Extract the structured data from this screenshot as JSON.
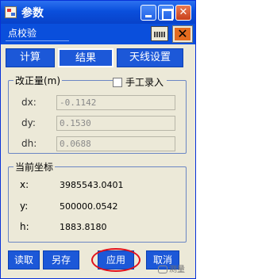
{
  "window": {
    "title": "参数"
  },
  "subbar": {
    "mode": "点校验"
  },
  "tabs": [
    {
      "label": "计算"
    },
    {
      "label": "结果"
    },
    {
      "label": "天线设置"
    }
  ],
  "correction": {
    "legend": "改正量(m)",
    "manual_label": "手工录入",
    "manual_checked": false,
    "rows": [
      {
        "label": "dx:",
        "value": "-0.1142"
      },
      {
        "label": "dy:",
        "value": "0.1530"
      },
      {
        "label": "dh:",
        "value": "0.0688"
      }
    ]
  },
  "coords": {
    "legend": "当前坐标",
    "rows": [
      {
        "label": "x:",
        "value": "3985543.0401"
      },
      {
        "label": "y:",
        "value": "500000.0542"
      },
      {
        "label": "h:",
        "value": "1883.8180"
      }
    ]
  },
  "buttons": {
    "read": "读取",
    "save_as": "另存",
    "apply": "应用",
    "cancel": "取消"
  },
  "watermark": {
    "text": "测量"
  },
  "colors": {
    "title_blue": "#0a4fdc",
    "tab_blue": "#1c58d8",
    "highlight_ring": "#e0101c",
    "face": "#ece9d8"
  }
}
